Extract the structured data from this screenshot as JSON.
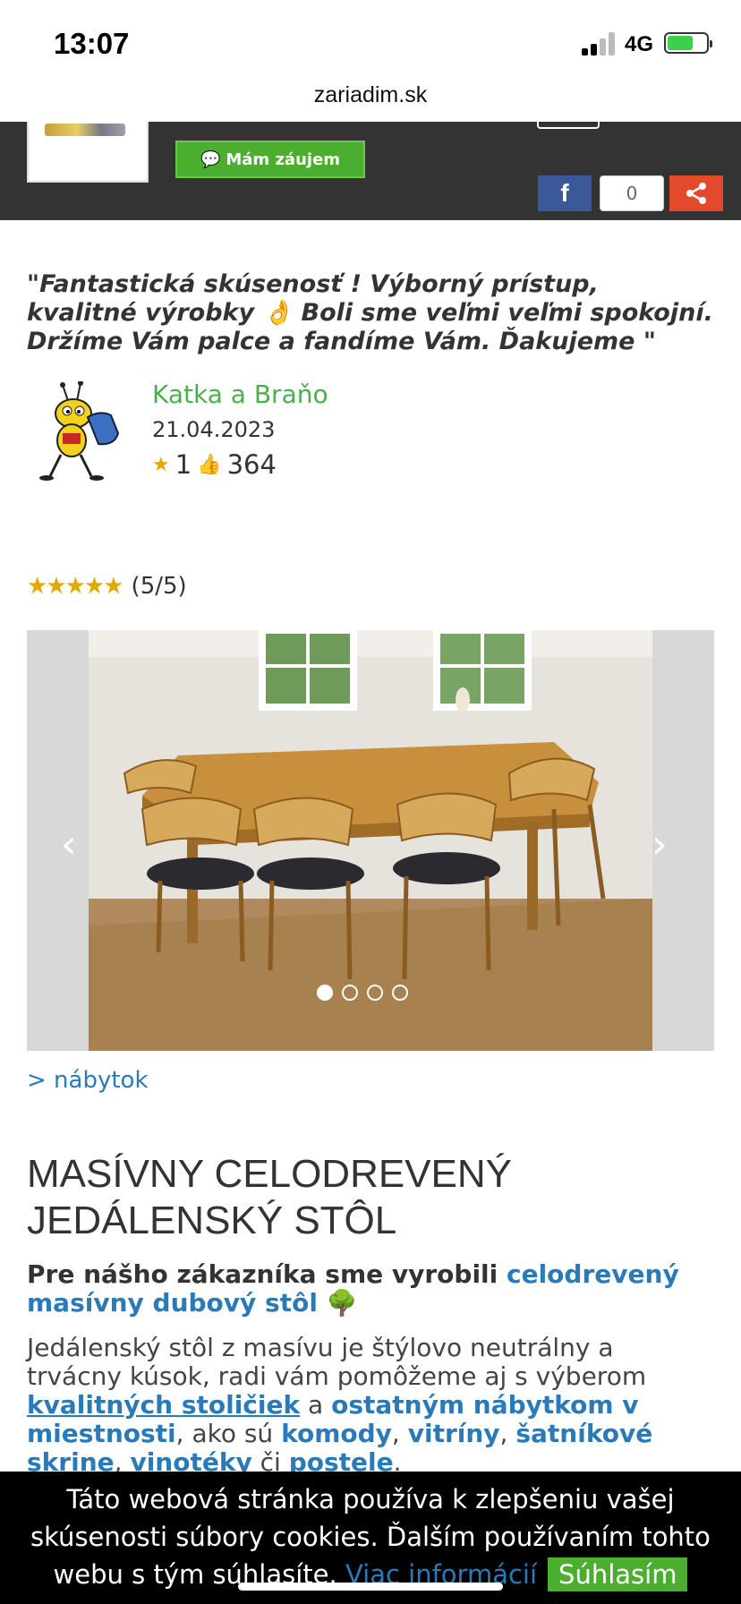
{
  "status_bar": {
    "time": "13:07",
    "network": "4G"
  },
  "browser": {
    "url": "zariadim.sk"
  },
  "header": {
    "interest_button": "Mám záujem",
    "facebook_letter": "f",
    "share_count": "0"
  },
  "testimonial": {
    "quote": "\"Fantastická skúsenosť ! Výborný prístup, kvalitné výrobky 👌 Boli sme veľmi veľmi spokojní. Držíme Vám palce a fandíme Vám. Ďakujeme \"",
    "author": "Katka a Braňo",
    "date": "21.04.2023",
    "stars_count": "1",
    "likes_count": "364"
  },
  "rating": {
    "stars": "★★★★★",
    "text": "(5/5)"
  },
  "carousel": {
    "slides": 4,
    "active_index": 0
  },
  "breadcrumb": "> nábytok",
  "article": {
    "title": "MASÍVNY CELODREVENÝ JEDÁLENSKÝ STÔL",
    "sub_plain": "Pre nášho zákazníka sme vyrobili ",
    "sub_highlight": "celodrevený masívny dubový stôl",
    "sub_emoji": " 🌳",
    "p_1": "Jedálenský stôl z masívu je štýlovo neutrálny a trvácny kúsok, radi vám pomôžeme aj s výberom ",
    "link_chairs": "kvalitných stoličiek",
    "p_2": " a ",
    "link_furniture": "ostatným nábytkom v miestnosti",
    "p_3": ", ako sú ",
    "link_dressers": "komody",
    "p_4": ", ",
    "link_cabinets": "vitríny",
    "p_5": ", ",
    "link_wardrobes": "šatníkové skrine",
    "p_6": ", ",
    "link_wine": "vinotéky",
    "p_7": " či ",
    "link_beds": "postele",
    "p_8": "."
  },
  "cookie_banner": {
    "text": "Táto webová stránka používa k zlepšeniu vašej skúsenosti súbory cookies. Ďalším používaním tohto webu s tým súhlasíte.",
    "more_link": "Viac informácií",
    "accept_button": "Súhlasím"
  }
}
